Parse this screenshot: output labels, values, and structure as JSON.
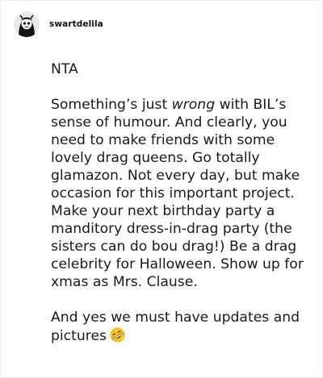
{
  "post": {
    "username": "swartdelila",
    "line1": "NTA",
    "para2_a": "Something’s just ",
    "para2_em": "wrong",
    "para2_b": " with BIL’s sense of humour. And clearly, you need to make friends with some lovely drag queens. Go totally glamazon. Not every day, but make occasion for this important project. Make your next birthday party a manditory dress-in-drag party (the sisters can do bou drag!) Be a drag celebrity for Halloween. Show up for xmas as Mrs. Clause.",
    "para3": "And yes we must have updates and pictures",
    "emoji_name": "rolling-on-floor-laughing-emoji"
  }
}
